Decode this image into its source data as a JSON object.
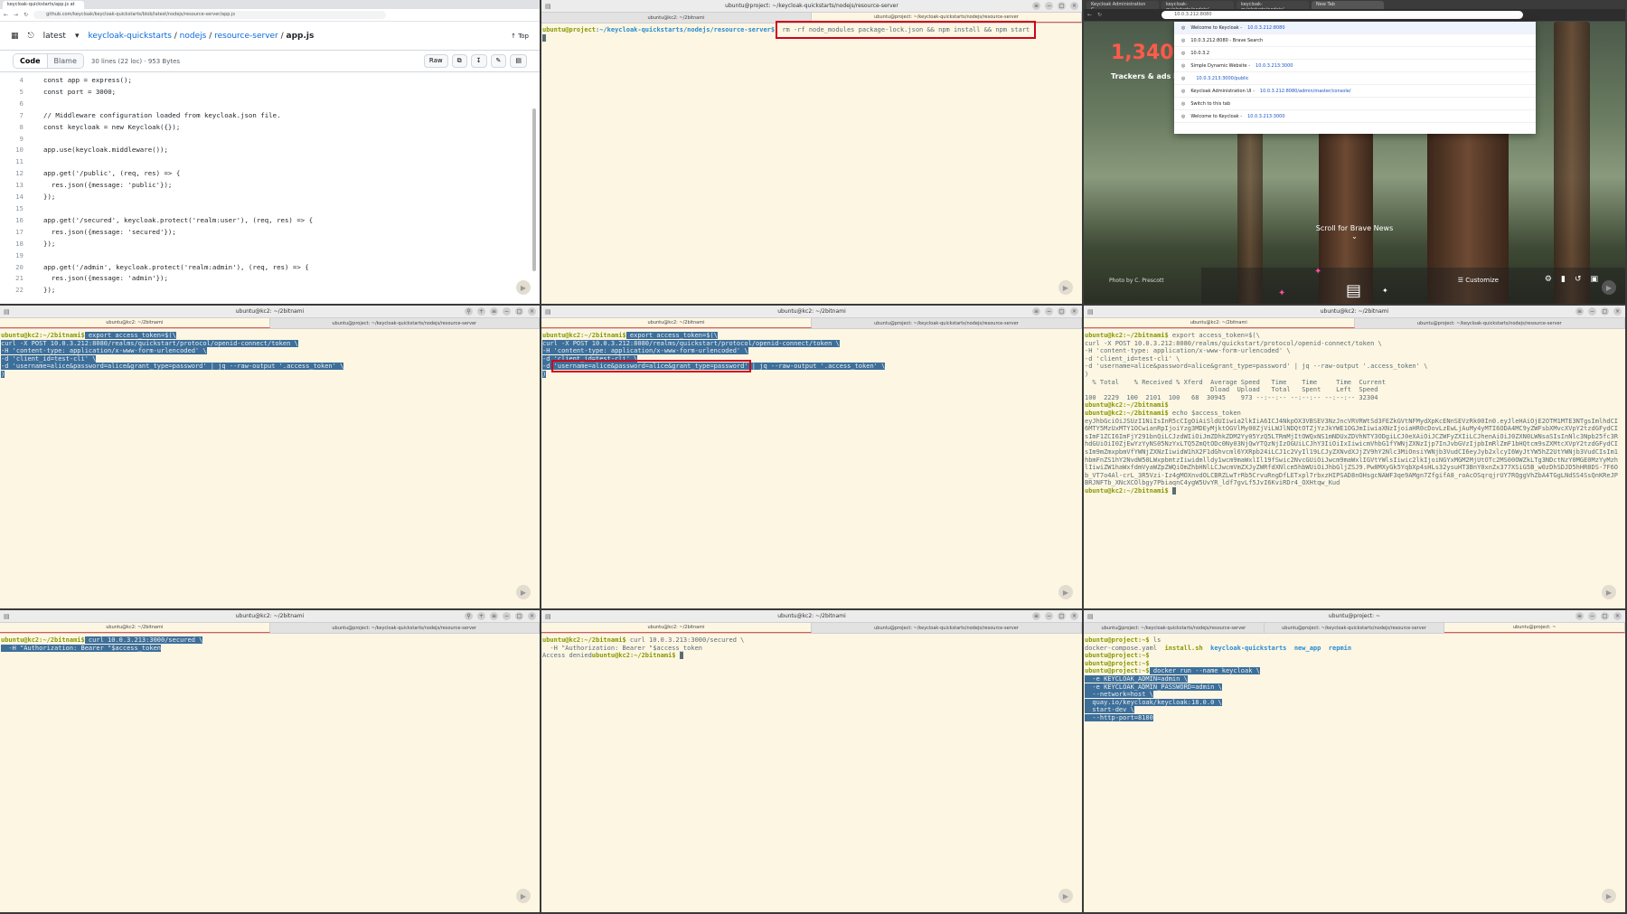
{
  "github": {
    "tab_title": "keycloak-quickstarts/app.js at ...",
    "url": "github.com/keycloak/keycloak-quickstarts/blob/latest/nodejs/resource-server/app.js",
    "branch": "latest",
    "repo": "keycloak-quickstarts",
    "path1": "nodejs",
    "path2": "resource-server",
    "file": "app.js",
    "top_label": "Top",
    "code_tab": "Code",
    "blame_tab": "Blame",
    "meta": "30 lines (22 loc) · 953 Bytes",
    "raw_label": "Raw",
    "lines": [
      {
        "n": "4",
        "t": "const app = express();"
      },
      {
        "n": "5",
        "t": "const port = 3000;"
      },
      {
        "n": "6",
        "t": ""
      },
      {
        "n": "7",
        "t": "// Middleware configuration loaded from keycloak.json file."
      },
      {
        "n": "8",
        "t": "const keycloak = new Keycloak({});"
      },
      {
        "n": "9",
        "t": ""
      },
      {
        "n": "10",
        "t": "app.use(keycloak.middleware());"
      },
      {
        "n": "11",
        "t": ""
      },
      {
        "n": "12",
        "t": "app.get('/public', (req, res) => {"
      },
      {
        "n": "13",
        "t": "  res.json({message: 'public'});"
      },
      {
        "n": "14",
        "t": "});"
      },
      {
        "n": "15",
        "t": ""
      },
      {
        "n": "16",
        "t": "app.get('/secured', keycloak.protect('realm:user'), (req, res) => {"
      },
      {
        "n": "17",
        "t": "  res.json({message: 'secured'});"
      },
      {
        "n": "18",
        "t": "});"
      },
      {
        "n": "19",
        "t": ""
      },
      {
        "n": "20",
        "t": "app.get('/admin', keycloak.protect('realm:admin'), (req, res) => {"
      },
      {
        "n": "21",
        "t": "  res.json({message: 'admin'});"
      },
      {
        "n": "22",
        "t": "});"
      }
    ]
  },
  "term_top": {
    "title": "ubuntu@project: ~/keycloak-quickstarts/nodejs/resource-server",
    "tab1": "ubuntu@kc2: ~/2bitnami",
    "prompt_user": "ubuntu@project",
    "prompt_path": ":~/keycloak-quickstarts/nodejs/resource-server$",
    "command": "rm -rf node_modules package-lock.json && npm install && npm start"
  },
  "brave": {
    "tabs": [
      "Keycloak Administration C...",
      "keycloak-quickstarts/nodejs/...",
      "keycloak-quickstarts/nodejs/...",
      "New Tab"
    ],
    "address": "10.0.3.212:8080",
    "number": "1,340,0",
    "trackers": "Trackers & ads b",
    "scroll": "Scroll for Brave News",
    "photo": "Photo by C. Prescott",
    "customize": "Customize",
    "suggestions": [
      {
        "t": "Welcome to Keycloak - ",
        "u": "10.0.3.212:8080"
      },
      {
        "t": "10.0.3.212:8080 - Brave Search",
        "u": ""
      },
      {
        "t": "10.0.3.2",
        "u": ""
      },
      {
        "t": "Simple Dynamic Website - ",
        "u": "10.0.3.213:3000"
      },
      {
        "t": "",
        "u": "10.0.3.213:3000/public"
      },
      {
        "t": "Keycloak Administration UI - ",
        "u": "10.0.3.212:8080/admin/master/console/"
      },
      {
        "t": "Switch to this tab",
        "u": ""
      },
      {
        "t": "Welcome to Keycloak - ",
        "u": "10.0.3.213:3000"
      }
    ]
  },
  "term_m1": {
    "title": "ubuntu@kc2: ~/2bitnami",
    "tabs": [
      "ubuntu@kc2: ~/2bitnami",
      "ubuntu@project: ~/keycloak-quickstarts/nodejs/resource-server"
    ],
    "prompt": "ubuntu@kc2:~/2bitnami$",
    "lines": [
      " export access_token=$(\\",
      "curl -X POST 10.0.3.212:8080/realms/quickstart/protocol/openid-connect/token \\",
      "-H 'content-type: application/x-www-form-urlencoded' \\",
      "-d 'client_id=test-cli' \\",
      "-d 'username=alice&password=alice&grant_type=password' | jq --raw-output '.access_token' \\",
      ")"
    ]
  },
  "term_m2": {
    "title": "ubuntu@kc2: ~/2bitnami",
    "tabs": [
      "ubuntu@kc2: ~/2bitnami",
      "ubuntu@project: ~/keycloak-quickstarts/nodejs/resource-server"
    ],
    "prompt": "ubuntu@kc2:~/2bitnami$",
    "l1": " export access_token=$(\\",
    "l2": "curl -X POST 10.0.3.212:8080/realms/quickstart/protocol/openid-connect/token \\",
    "l3": "-H 'content-type: application/x-www-form-urlencoded' \\",
    "l4": "-d 'client_id=test-cli' \\",
    "l5a": "-d ",
    "l5b": "'username=alice&password=alice&grant_type=password'",
    "l5c": " | jq --raw-output '.access_token' \\",
    "l6": ")"
  },
  "term_m3": {
    "title": "ubuntu@kc2: ~/2bitnami",
    "tabs": [
      "ubuntu@kc2: ~/2bitnami",
      "ubuntu@project: ~/keycloak-quickstarts/nodejs/resource-server"
    ],
    "prompt": "ubuntu@kc2:~/2bitnami$",
    "lines": [
      " export access_token=$(\\",
      "curl -X POST 10.0.3.212:8080/realms/quickstart/protocol/openid-connect/token \\",
      "-H 'content-type: application/x-www-form-urlencoded' \\",
      "-d 'client_id=test-cli' \\",
      "-d 'username=alice&password=alice&grant_type=password' | jq --raw-output '.access_token' \\",
      ")",
      "  % Total    % Received % Xferd  Average Speed   Time    Time     Time  Current",
      "                                 Dload  Upload   Total   Spent    Left  Speed",
      "100  2229  100  2101  100   68  30945    973 --:--:-- --:--:-- --:--:-- 32304"
    ],
    "echo_cmd": " echo $access_token",
    "token": "eyJhbGciOiJSUzI1NiIsInR5cCIgOiAiSldUIiwia2lkIiA6ICJ4NkpOX3VBSEV3NzJncVRVRWtSd3FEZkGVtNFMydXpKcENnSEVzRk00In0.eyJleHAiOjE2OTM1MTE3NTgsImlhdCI6MTY5MzUxMTY1OCwianRpIjoiYzg3MDEyMjktOGVlMy00ZjViLWJlNDQtOTZjYzJkYWE1OGJmIiwiaXNzIjoiaHR0cDovLzEwLjAuMy4yMTI6ODA4MC9yZWFsbXMvcXVpY2tzdGFydCIsImF1ZCI6ImFjY291bnQiLCJzdWIiOiJmZDhkZDM2Yy05YzQ5LTRmMjItOWQxNS1mNDUxZDVhNTY3ODgiLCJ0eXAiOiJCZWFyZXIiLCJhenAiOiJ0ZXN0LWNsaSIsInNlc3Npb25fc3RhdGUiOiI0ZjEwYzYyNS05NzYxLTQ5ZmQtODc0Ny03NjQwYTQzNjIzOGUiLCJhY3IiOiIxIiwicmVhbG1fYWNjZXNzIjp7InJvbGVzIjpbImRlZmF1bHQtcm9sZXMtcXVpY2tzdGFydCIsIm9mZmxpbmVfYWNjZXNzIiwidW1hX2F1dGhvcml6YXRpb24iLCJ1c2VyIl19LCJyZXNvdXJjZV9hY2Nlc3MiOnsiYWNjb3VudCI6eyJyb2xlcyI6WyJtYW5hZ2UtYWNjb3VudCIsIm1hbmFnZS1hY2NvdW50LWxpbmtzIiwidmlldy1wcm9maWxlIl19fSwic2NvcGUiOiJwcm9maWxlIGVtYWlsIiwic2lkIjoiNGYxMGM2MjUtOTc2MS00OWZkLTg3NDctNzY0MGE0MzYyMzhlIiwiZW1haWxfdmVyaWZpZWQiOmZhbHNlLCJwcmVmZXJyZWRfdXNlcm5hbWUiOiJhbGljZSJ9.Pw8MXyGk5YqbXp4sHLs32ysuHT3BnY0xnZx377XSiG5B_w0zDhSDJD5hHR8DS-7F6Ob_VT7o4Al-crL_3R5Vzi-Iz4gMOXnvdOLCBRZLwTrRb5CrvuRngDfLETxpl7rbxzHIPSAD8nOHsgcNAWF3qe9AMgn7ZfgifA8_roAcOSqrqjrUY7RQggVhZbA4TGgLNdSS4SsQnKReJPBRJNFTb_XNcXCOlbgy7PbiaqnC4ygW5UvYR_ldf7gvLf5JvI6KviRDr4_OXHtqw_Kud",
    "final_prompt": "ubuntu@kc2:~/2bitnami$"
  },
  "term_b1": {
    "title": "ubuntu@kc2: ~/2bitnami",
    "tabs": [
      "ubuntu@kc2: ~/2bitnami",
      "ubuntu@project: ~/keycloak-quickstarts/nodejs/resource-server"
    ],
    "prompt": "ubuntu@kc2:~/2bitnami$",
    "l1": " curl 10.0.3.213:3000/secured \\",
    "l2": "  -H \"Authorization: Bearer \"$access_token"
  },
  "term_b2": {
    "title": "ubuntu@kc2: ~/2bitnami",
    "tabs": [
      "ubuntu@kc2: ~/2bitnami",
      "ubuntu@project: ~/keycloak-quickstarts/nodejs/resource-server"
    ],
    "prompt": "ubuntu@kc2:~/2bitnami$",
    "l1": " curl 10.0.3.213:3000/secured \\",
    "l2": "  -H \"Authorization: Bearer \"$access_token",
    "l3": "Access denied"
  },
  "term_b3": {
    "title": "ubuntu@project: ~",
    "tabs": [
      "ubuntu@project: ~/keycloak-quickstarts/nodejs/resource-server",
      "ubuntu@project: ~/keycloak-quickstarts/nodejs/resource-server",
      "ubuntu@project: ~"
    ],
    "prompt": "ubuntu@project:~$",
    "ls": " ls",
    "files": [
      "docker-compose.yaml",
      "install.sh",
      "keycloak-quickstarts",
      "new_app",
      "repmin"
    ],
    "docker": [
      " docker run --name keycloak \\",
      "  -e KEYCLOAK_ADMIN=admin \\",
      "  -e KEYCLOAK_ADMIN_PASSWORD=admin \\",
      "  --network=host \\",
      "  quay.io/keycloak/keycloak:18.0.0 \\",
      "  start-dev \\",
      "  --http-port=8180"
    ]
  }
}
